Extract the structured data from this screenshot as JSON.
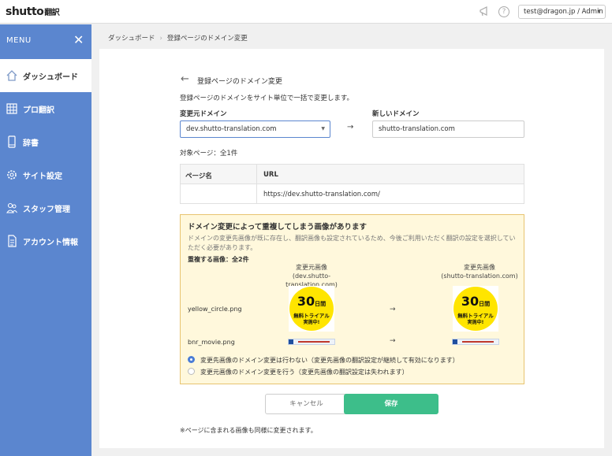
{
  "app": {
    "logo_main": "shutto",
    "logo_sub": "翻訳",
    "user_menu": "test@dragon.jp / Admin"
  },
  "sidebar": {
    "menu_label": "MENU",
    "items": [
      {
        "label": "ダッシュボード",
        "icon": "home-icon",
        "active": true
      },
      {
        "label": "プロ翻訳",
        "icon": "grid-icon",
        "active": false
      },
      {
        "label": "辞書",
        "icon": "book-icon",
        "active": false
      },
      {
        "label": "サイト設定",
        "icon": "gear-icon",
        "active": false
      },
      {
        "label": "スタッフ管理",
        "icon": "users-icon",
        "active": false
      },
      {
        "label": "アカウント情報",
        "icon": "document-icon",
        "active": false
      }
    ]
  },
  "breadcrumb": {
    "items": [
      "ダッシュボード",
      "登録ページのドメイン変更"
    ]
  },
  "page": {
    "title": "登録ページのドメイン変更",
    "description": "登録ページのドメインをサイト単位で一括で変更します。",
    "source_label": "変更元ドメイン",
    "source_value": "dev.shutto-translation.com",
    "dest_label": "新しいドメイン",
    "dest_value": "shutto-translation.com",
    "page_count": "対象ページ：全1件"
  },
  "table": {
    "headers": [
      "ページ名",
      "URL"
    ],
    "rows": [
      [
        "",
        "https://dev.shutto-translation.com/"
      ]
    ]
  },
  "warning": {
    "title": "ドメイン変更によって重複してしまう画像があります",
    "description": "ドメインの変更先画像が既に存在し、翻訳画像も設定されているため、今後ご利用いただく翻訳の設定を選択していただく必要があります。",
    "count": "重複する画像：全2件",
    "src_col_title": "変更元画像",
    "src_col_domain": "(dev.shutto-translation.com)",
    "dst_col_title": "変更先画像",
    "dst_col_domain": "(shutto-translation.com)",
    "images": [
      {
        "filename": "yellow_circle.png",
        "badge_number": "30",
        "badge_unit": "日間",
        "badge_line1": "無料トライアル",
        "badge_line2": "実施中!"
      },
      {
        "filename": "bnr_movie.png"
      }
    ],
    "options": [
      {
        "label": "変更先画像のドメイン変更は行わない（変更先画像の翻訳設定が継続して有効になります）",
        "selected": true
      },
      {
        "label": "変更元画像のドメイン変更を行う（変更先画像の翻訳設定は失われます）",
        "selected": false
      }
    ]
  },
  "buttons": {
    "cancel": "キャンセル",
    "save": "保存"
  },
  "footnote": "※ページに含まれる画像も同様に変更されます。",
  "colors": {
    "sidebar": "#5b86cf",
    "save_button": "#3dbe8a",
    "warning_bg": "#fff8dc",
    "warning_border": "#e8c470"
  }
}
